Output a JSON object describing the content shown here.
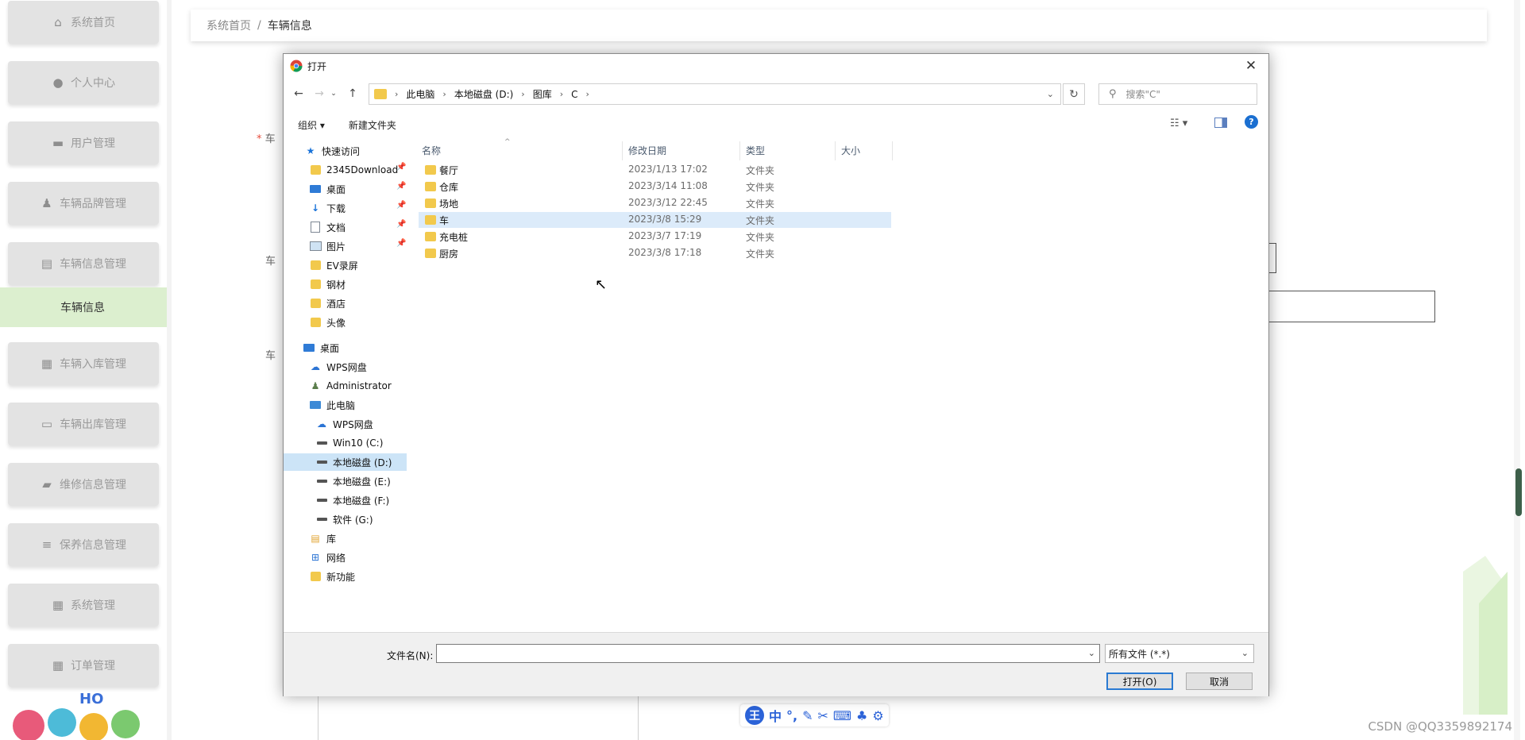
{
  "sidebar": {
    "items": [
      {
        "label": "系统首页",
        "icon": "home-icon"
      },
      {
        "label": "个人中心",
        "icon": "user-icon"
      },
      {
        "label": "用户管理",
        "icon": "monitor-icon"
      },
      {
        "label": "车辆品牌管理",
        "icon": "person-icon"
      },
      {
        "label": "车辆信息管理",
        "icon": "clipboard-icon"
      },
      {
        "label": "车辆入库管理",
        "icon": "grid-icon"
      },
      {
        "label": "车辆出库管理",
        "icon": "chat-icon"
      },
      {
        "label": "维修信息管理",
        "icon": "ticket-icon"
      },
      {
        "label": "保养信息管理",
        "icon": "sliders-icon"
      },
      {
        "label": "系统管理",
        "icon": "grid-icon"
      },
      {
        "label": "订单管理",
        "icon": "grid-icon"
      }
    ],
    "active_item": "车辆信息"
  },
  "breadcrumb": {
    "home": "系统首页",
    "separator": "/",
    "current": "车辆信息"
  },
  "form": {
    "label_1": "车",
    "label_2": "车",
    "label_3": "车",
    "required_mark": "*"
  },
  "watermark": "CSDN @QQ3359892174",
  "ime": {
    "logo": "王",
    "mode": "中"
  },
  "dialog": {
    "title": "打开",
    "close": "✕",
    "address": [
      "此电脑",
      "本地磁盘 (D:)",
      "图库",
      "C"
    ],
    "search_placeholder": "搜索\"C\"",
    "toolbar": {
      "organize": "组织 ▾",
      "new_folder": "新建文件夹",
      "help": "?"
    },
    "nav_pane": [
      {
        "label": "快速访问",
        "icon": "star-icon",
        "indent": 0
      },
      {
        "label": "2345Download",
        "icon": "folder-icon",
        "indent": 1,
        "pinned": true
      },
      {
        "label": "桌面",
        "icon": "desktop-icon",
        "indent": 1,
        "pinned": true
      },
      {
        "label": "下载",
        "icon": "download-icon",
        "indent": 1,
        "pinned": true
      },
      {
        "label": "文档",
        "icon": "document-icon",
        "indent": 1,
        "pinned": true
      },
      {
        "label": "图片",
        "icon": "picture-icon",
        "indent": 1,
        "pinned": true
      },
      {
        "label": "EV录屏",
        "icon": "folder-icon",
        "indent": 1
      },
      {
        "label": "钢材",
        "icon": "folder-icon",
        "indent": 1
      },
      {
        "label": "酒店",
        "icon": "folder-icon",
        "indent": 1
      },
      {
        "label": "头像",
        "icon": "folder-icon",
        "indent": 1
      },
      {
        "label": "桌面",
        "icon": "desktop-icon",
        "indent": 0
      },
      {
        "label": "WPS网盘",
        "icon": "cloud-icon",
        "indent": 1
      },
      {
        "label": "Administrator",
        "icon": "user-icon",
        "indent": 1
      },
      {
        "label": "此电脑",
        "icon": "pc-icon",
        "indent": 1
      },
      {
        "label": "WPS网盘",
        "icon": "cloud-icon",
        "indent": 2
      },
      {
        "label": "Win10 (C:)",
        "icon": "drive-icon",
        "indent": 2
      },
      {
        "label": "本地磁盘 (D:)",
        "icon": "drive-icon",
        "indent": 2,
        "selected": true
      },
      {
        "label": "本地磁盘 (E:)",
        "icon": "drive-icon",
        "indent": 2
      },
      {
        "label": "本地磁盘 (F:)",
        "icon": "drive-icon",
        "indent": 2
      },
      {
        "label": "软件 (G:)",
        "icon": "drive-icon",
        "indent": 2
      },
      {
        "label": "库",
        "icon": "library-icon",
        "indent": 1
      },
      {
        "label": "网络",
        "icon": "network-icon",
        "indent": 1
      },
      {
        "label": "新功能",
        "icon": "folder-icon",
        "indent": 1
      }
    ],
    "columns": [
      "名称",
      "修改日期",
      "类型",
      "大小"
    ],
    "files": [
      {
        "name": "餐厅",
        "date": "2023/1/13 17:02",
        "type": "文件夹"
      },
      {
        "name": "仓库",
        "date": "2023/3/14 11:08",
        "type": "文件夹"
      },
      {
        "name": "场地",
        "date": "2023/3/12 22:45",
        "type": "文件夹"
      },
      {
        "name": "车",
        "date": "2023/3/8 15:29",
        "type": "文件夹",
        "hover": true
      },
      {
        "name": "充电桩",
        "date": "2023/3/7 17:19",
        "type": "文件夹"
      },
      {
        "name": "厨房",
        "date": "2023/3/8 17:18",
        "type": "文件夹"
      }
    ],
    "filename_label": "文件名(N):",
    "filename_value": "",
    "filetype": "所有文件 (*.*)",
    "open_button": "打开(O)",
    "cancel_button": "取消"
  }
}
